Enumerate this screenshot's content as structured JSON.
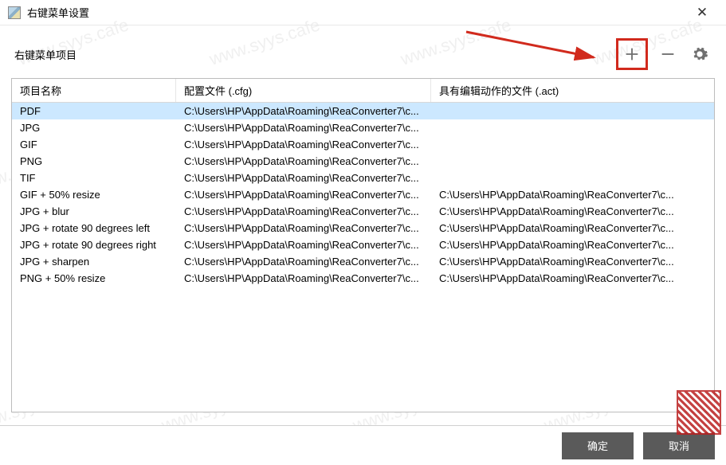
{
  "window": {
    "title": "右键菜单设置"
  },
  "section": {
    "label": "右键菜单项目"
  },
  "toolbar": {
    "add_tooltip": "添加",
    "remove_tooltip": "删除",
    "settings_tooltip": "设置"
  },
  "columns": {
    "name": "项目名称",
    "cfg": "配置文件 (.cfg)",
    "act": "具有编辑动作的文件 (.act)"
  },
  "rows": [
    {
      "name": "PDF",
      "cfg": "C:\\Users\\HP\\AppData\\Roaming\\ReaConverter7\\c...",
      "act": "",
      "selected": true
    },
    {
      "name": "JPG",
      "cfg": "C:\\Users\\HP\\AppData\\Roaming\\ReaConverter7\\c...",
      "act": ""
    },
    {
      "name": "GIF",
      "cfg": "C:\\Users\\HP\\AppData\\Roaming\\ReaConverter7\\c...",
      "act": ""
    },
    {
      "name": "PNG",
      "cfg": "C:\\Users\\HP\\AppData\\Roaming\\ReaConverter7\\c...",
      "act": ""
    },
    {
      "name": "TIF",
      "cfg": "C:\\Users\\HP\\AppData\\Roaming\\ReaConverter7\\c...",
      "act": ""
    },
    {
      "name": "GIF + 50% resize",
      "cfg": "C:\\Users\\HP\\AppData\\Roaming\\ReaConverter7\\c...",
      "act": "C:\\Users\\HP\\AppData\\Roaming\\ReaConverter7\\c..."
    },
    {
      "name": "JPG + blur",
      "cfg": "C:\\Users\\HP\\AppData\\Roaming\\ReaConverter7\\c...",
      "act": "C:\\Users\\HP\\AppData\\Roaming\\ReaConverter7\\c..."
    },
    {
      "name": "JPG + rotate 90 degrees left",
      "cfg": "C:\\Users\\HP\\AppData\\Roaming\\ReaConverter7\\c...",
      "act": "C:\\Users\\HP\\AppData\\Roaming\\ReaConverter7\\c..."
    },
    {
      "name": "JPG + rotate 90 degrees right",
      "cfg": "C:\\Users\\HP\\AppData\\Roaming\\ReaConverter7\\c...",
      "act": "C:\\Users\\HP\\AppData\\Roaming\\ReaConverter7\\c..."
    },
    {
      "name": "JPG + sharpen",
      "cfg": "C:\\Users\\HP\\AppData\\Roaming\\ReaConverter7\\c...",
      "act": "C:\\Users\\HP\\AppData\\Roaming\\ReaConverter7\\c..."
    },
    {
      "name": "PNG + 50% resize",
      "cfg": "C:\\Users\\HP\\AppData\\Roaming\\ReaConverter7\\c...",
      "act": "C:\\Users\\HP\\AppData\\Roaming\\ReaConverter7\\c..."
    }
  ],
  "footer": {
    "ok": "确定",
    "cancel": "取消"
  },
  "watermark": "www.syys.cafe"
}
